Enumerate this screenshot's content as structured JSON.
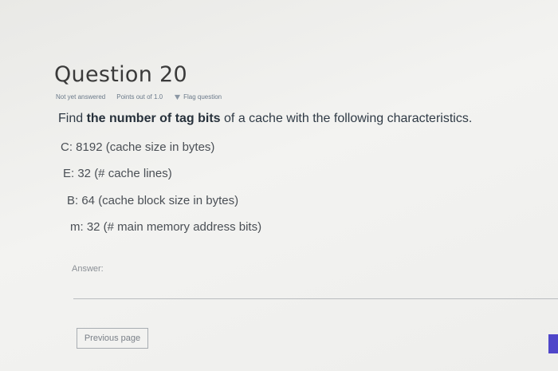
{
  "question": {
    "title": "Question 20",
    "status": "Not yet answered",
    "points": "Points out of 1.0",
    "flag_label": "Flag question",
    "prompt_prefix": "Find ",
    "prompt_bold": "the number of tag bits",
    "prompt_suffix": " of a cache with the following characteristics.",
    "params": [
      "C: 8192 (cache size in bytes)",
      "E: 32 (# cache lines)",
      "B: 64 (cache block size in bytes)",
      "m: 32 (# main memory address bits)"
    ],
    "answer_label": "Answer:",
    "answer_value": ""
  },
  "navigation": {
    "previous_label": "Previous page"
  },
  "colors": {
    "accent": "#4f46c9",
    "link": "#6b7a8a"
  },
  "icons": {
    "flag": "flag-icon"
  }
}
